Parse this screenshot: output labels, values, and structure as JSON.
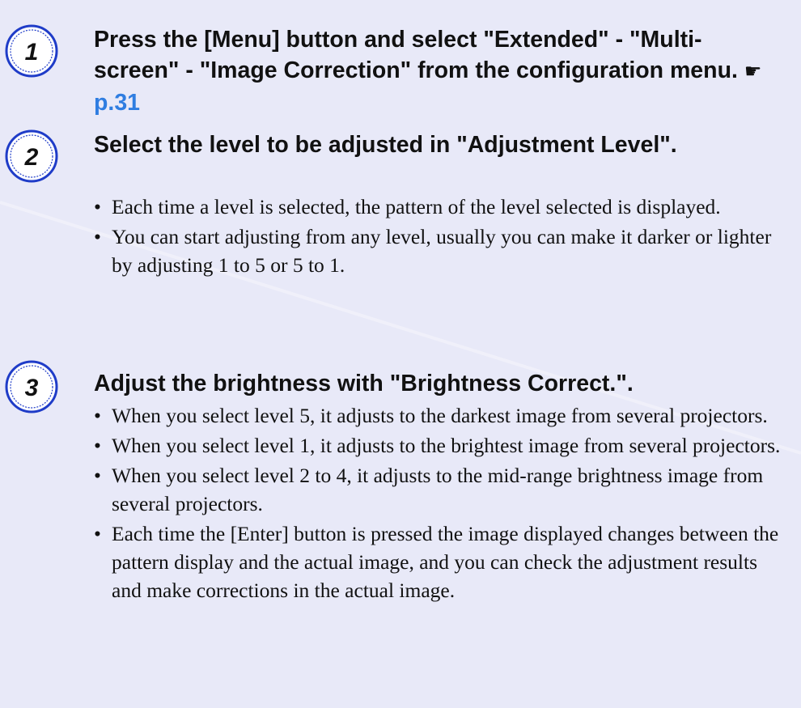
{
  "steps": [
    {
      "number": "1",
      "heading": "Press the [Menu] button and select \"Extended\" - \"Multi-screen\" - \"Image Correction\" from the configuration menu.",
      "link_icon": "pointing-hand-icon",
      "link": "p.31"
    },
    {
      "number": "2",
      "heading": "Select the level to be adjusted in \"Adjustment Level\".",
      "bullets": [
        "Each time a level is selected, the pattern of the level selected is displayed.",
        "You can start adjusting from any level, usually you can make it darker or lighter by adjusting 1 to 5 or 5 to 1."
      ]
    },
    {
      "number": "3",
      "heading": "Adjust the brightness with \"Brightness Correct.\".",
      "bullets": [
        "When you select level 5, it adjusts to the darkest image from several projectors.",
        "When you select level 1, it adjusts to the brightest image from several projectors.",
        "When you select level 2 to 4, it adjusts to the mid-range brightness image from several projectors.",
        "Each time the [Enter] button is pressed the image displayed changes between the pattern display and the actual image, and you can check the adjustment results and make corrections in the actual image."
      ]
    }
  ],
  "colors": {
    "background": "#e8e9f8",
    "badge_blue": "#1f3cc8",
    "link_blue": "#2f7de1"
  }
}
